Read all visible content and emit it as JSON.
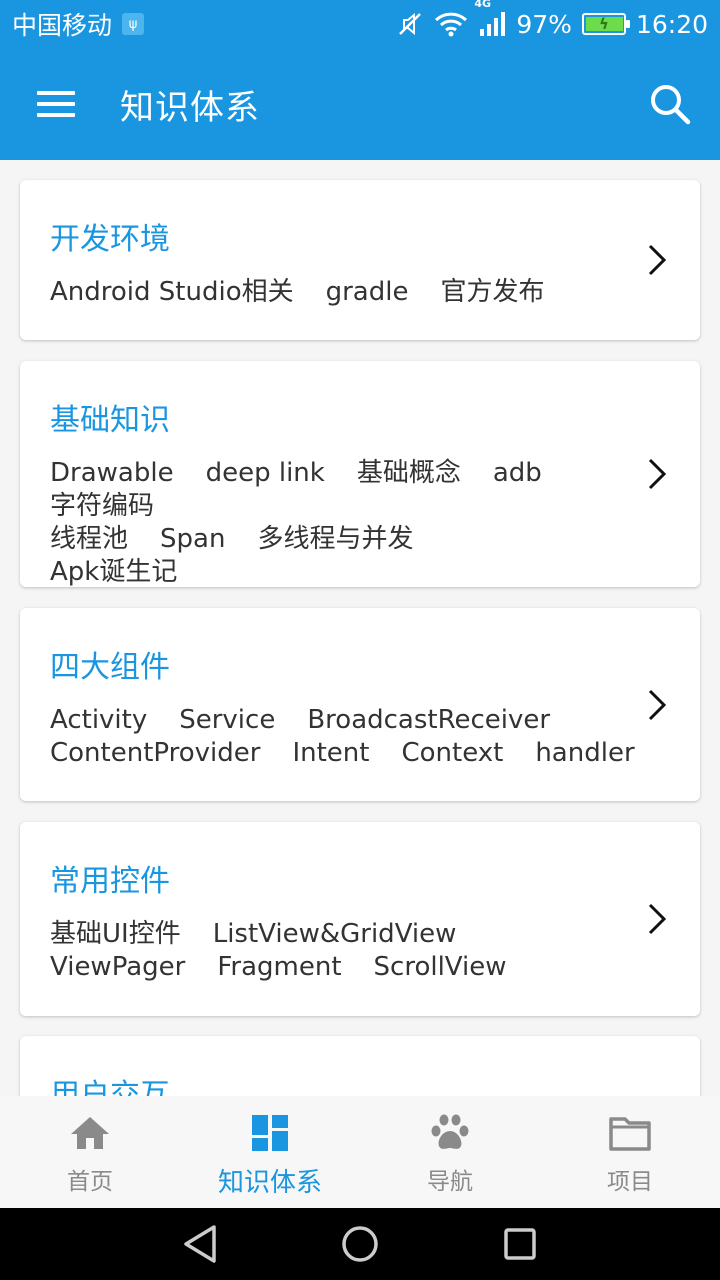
{
  "status_bar": {
    "carrier": "中国移动",
    "network": "4G",
    "battery": "97%",
    "time": "16:20",
    "icons": [
      "usb-icon",
      "mute-icon",
      "wifi-icon",
      "signal-icon",
      "battery-icon"
    ]
  },
  "app_bar": {
    "title": "知识体系",
    "menu_icon": "menu-icon",
    "search_icon": "search-icon"
  },
  "cards": [
    {
      "title": "开发环境",
      "tags": [
        "Android Studio相关",
        "gradle",
        "官方发布"
      ]
    },
    {
      "title": "基础知识",
      "tags": [
        "Drawable",
        "deep link",
        "基础概念",
        "adb",
        "字符编码",
        "线程池",
        "Span",
        "多线程与并发",
        "Apk诞生记"
      ]
    },
    {
      "title": "四大组件",
      "tags": [
        "Activity",
        "Service",
        "BroadcastReceiver",
        "ContentProvider",
        "Intent",
        "Context",
        "handler"
      ]
    },
    {
      "title": "常用控件",
      "tags": [
        "基础UI控件",
        "ListView&GridView",
        "ViewPager",
        "Fragment",
        "ScrollView"
      ]
    },
    {
      "title": "用户交互",
      "tags": []
    }
  ],
  "bottom_nav": {
    "items": [
      {
        "label": "首页",
        "icon": "home-icon",
        "active": false
      },
      {
        "label": "知识体系",
        "icon": "dashboard-icon",
        "active": true
      },
      {
        "label": "导航",
        "icon": "paw-icon",
        "active": false
      },
      {
        "label": "项目",
        "icon": "folder-icon",
        "active": false
      }
    ]
  },
  "colors": {
    "primary": "#1a96e0",
    "text": "#333333",
    "inactive": "#8a8a8a"
  }
}
